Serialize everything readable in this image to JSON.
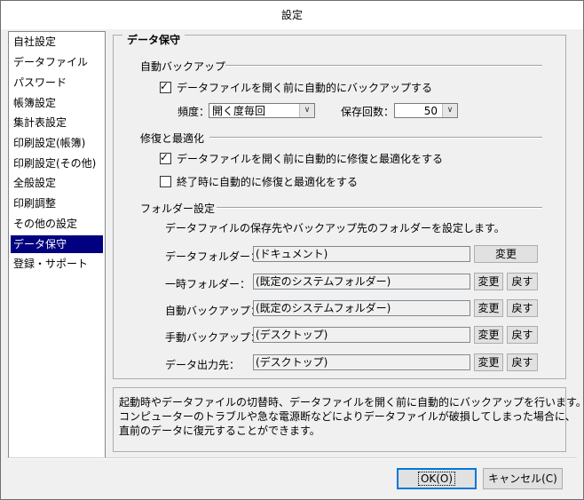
{
  "window": {
    "title": "設定"
  },
  "sidebar": {
    "items": [
      {
        "label": "自社設定"
      },
      {
        "label": "データファイル"
      },
      {
        "label": "パスワード"
      },
      {
        "label": "帳簿設定"
      },
      {
        "label": "集計表設定"
      },
      {
        "label": "印刷設定(帳簿)"
      },
      {
        "label": "印刷設定(その他)"
      },
      {
        "label": "全般設定"
      },
      {
        "label": "印刷調整"
      },
      {
        "label": "その他の設定"
      },
      {
        "label": "データ保守",
        "selected": true
      },
      {
        "label": "登録・サポート"
      }
    ]
  },
  "panel": {
    "title": "データ保守",
    "auto_backup": {
      "title": "自動バックアップ",
      "checkbox_label": "データファイルを開く前に自動的にバックアップする",
      "checkbox_checked": true,
      "frequency_label": "頻度：",
      "frequency_value": "開く度毎回",
      "count_label": "保存回数：",
      "count_value": "50"
    },
    "repair": {
      "title": "修復と最適化",
      "option1_label": "データファイルを開く前に自動的に修復と最適化をする",
      "option1_checked": true,
      "option2_label": "終了時に自動的に修復と最適化をする",
      "option2_checked": false
    },
    "folders": {
      "title": "フォルダー設定",
      "description": "データファイルの保存先やバックアップ先のフォルダーを設定します。",
      "rows": [
        {
          "label": "データフォルダー：",
          "value": "(ドキュメント)",
          "change": "変更",
          "reset": ""
        },
        {
          "label": "一時フォルダー：",
          "value": "(既定のシステムフォルダー)",
          "change": "変更",
          "reset": "戻す"
        },
        {
          "label": "自動バックアップ：",
          "value": "(既定のシステムフォルダー)",
          "change": "変更",
          "reset": "戻す"
        },
        {
          "label": "手動バックアップ：",
          "value": "(デスクトップ)",
          "change": "変更",
          "reset": "戻す"
        },
        {
          "label": "データ出力先：",
          "value": "(デスクトップ)",
          "change": "変更",
          "reset": "戻す"
        }
      ]
    }
  },
  "description_box": {
    "lines": [
      "起動時やデータファイルの切替時、データファイルを開く前に自動的にバックアップを行います。",
      "コンピューターのトラブルや急な電源断などによりデータファイルが破損してしまった場合に、",
      "直前のデータに復元することができます。"
    ]
  },
  "footer": {
    "ok_label": "OK(O)",
    "cancel_label": "キャンセル(C)"
  },
  "colors": {
    "selection": "#000080",
    "background": "#f0f0f0"
  }
}
